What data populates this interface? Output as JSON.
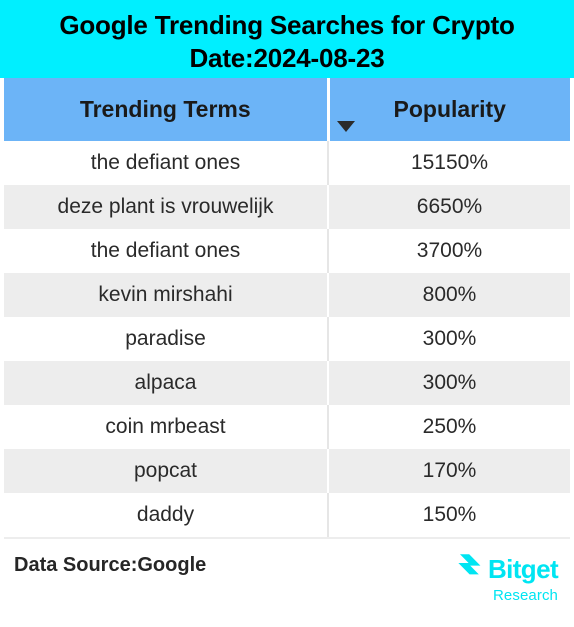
{
  "title": {
    "line1": "Google Trending Searches for Crypto",
    "line2": "Date:2024-08-23"
  },
  "table": {
    "columns": [
      {
        "label": "Trending Terms",
        "key": "term"
      },
      {
        "label": "Popularity",
        "key": "popularity",
        "sort": "descending",
        "sort_icon": "triangle-down-icon"
      }
    ],
    "rows": [
      {
        "term": "the defiant ones",
        "popularity": "15150%"
      },
      {
        "term": "deze plant is vrouwelijk",
        "popularity": "6650%"
      },
      {
        "term": "the defiant ones",
        "popularity": "3700%"
      },
      {
        "term": "kevin mirshahi",
        "popularity": "800%"
      },
      {
        "term": "paradise",
        "popularity": "300%"
      },
      {
        "term": "alpaca",
        "popularity": "300%"
      },
      {
        "term": "coin mrbeast",
        "popularity": "250%"
      },
      {
        "term": "popcat",
        "popularity": "170%"
      },
      {
        "term": "daddy",
        "popularity": "150%"
      }
    ]
  },
  "footer": {
    "source": "Data Source:Google",
    "brand_name": "Bitget",
    "brand_sub": "Research",
    "brand_mark": "bitget-logo-icon"
  },
  "colors": {
    "title_banner": "#00efff",
    "header_blue": "#6cb4f7",
    "row_alt_gray": "#ededed",
    "brand_cyan": "#00e5f2",
    "text_dark": "#2a2a2a"
  }
}
